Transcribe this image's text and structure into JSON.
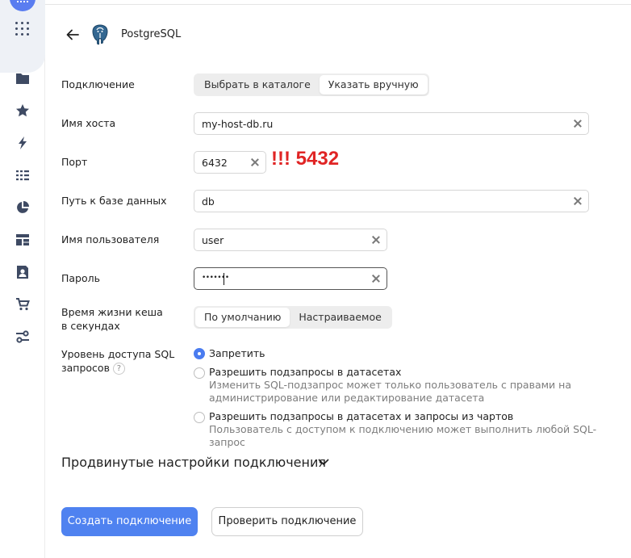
{
  "header": {
    "title": "PostgreSQL"
  },
  "annotation": "!!! 5432",
  "fields": {
    "connection": {
      "label": "Подключение",
      "options": [
        "Выбрать в каталоге",
        "Указать вручную"
      ],
      "selected": "Указать вручную"
    },
    "host": {
      "label": "Имя хоста",
      "value": "my-host-db.ru"
    },
    "port": {
      "label": "Порт",
      "value": "6432"
    },
    "db_path": {
      "label": "Путь к базе данных",
      "value": "db"
    },
    "username": {
      "label": "Имя пользователя",
      "value": "user"
    },
    "password": {
      "label": "Пароль",
      "value": "•••••••"
    },
    "cache_ttl": {
      "label_line1": "Время жизни кеша",
      "label_line2": "в секундах",
      "options": [
        "По умолчанию",
        "Настраиваемое"
      ],
      "selected": "По умолчанию"
    },
    "sql_access": {
      "label_line1": "Уровень доступа SQL",
      "label_line2": "запросов",
      "help": "?",
      "options": [
        {
          "label": "Запретить",
          "hint": "",
          "checked": true
        },
        {
          "label": "Разрешить подзапросы в датасетах",
          "hint_line1": "Изменить SQL-подзапрос может только пользователь с правами на",
          "hint_line2": "администрирование или редактирование датасета",
          "checked": false
        },
        {
          "label": "Разрешить подзапросы в датасетах и запросы из чартов",
          "hint_line1": "Пользователь с доступом к подключению может выполнить любой SQL-запрос",
          "checked": false
        }
      ]
    }
  },
  "advanced": {
    "label": "Продвинутые настройки подключения"
  },
  "buttons": {
    "create": "Создать подключение",
    "check": "Проверить подключение"
  },
  "colors": {
    "accent": "#4f82f0",
    "annotation": "#e02424",
    "rail_icon": "#3e4a63"
  },
  "rail": {
    "icons": [
      "apps-icon",
      "folder-icon",
      "star-icon",
      "lightning-icon",
      "list-icon",
      "pie-chart-icon",
      "dashboard-icon",
      "contact-icon",
      "cart-icon",
      "settings-sliders-icon"
    ]
  }
}
